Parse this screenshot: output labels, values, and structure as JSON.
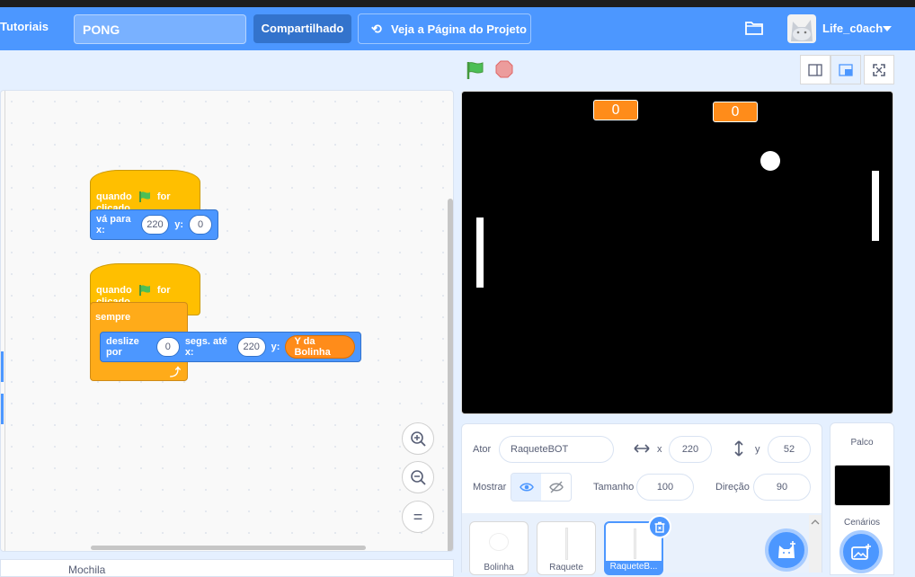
{
  "menubar": {
    "tutorials": "Tutoriais",
    "project_title": "PONG",
    "share": "Compartilhado",
    "see_project": "Veja a Página do Projeto",
    "username": "Life_c0ach"
  },
  "code": {
    "script1": {
      "hat_prefix": "quando",
      "hat_suffix": "for clicado",
      "goto_label": "vá para x:",
      "goto_x": "220",
      "goto_y_label": "y:",
      "goto_y": "0"
    },
    "script2": {
      "hat_prefix": "quando",
      "hat_suffix": "for clicado",
      "forever": "sempre",
      "glide_label": "deslize por",
      "glide_secs": "0",
      "glide_mid": "segs. até x:",
      "glide_x": "220",
      "glide_y_label": "y:",
      "glide_reporter": "Y da Bolinha"
    },
    "backpack": "Mochila"
  },
  "stage": {
    "score_left": "0",
    "score_right": "0"
  },
  "sprite_info": {
    "sprite_label": "Ator",
    "sprite_name": "RaqueteBOT",
    "x_label": "x",
    "x_value": "220",
    "y_label": "y",
    "y_value": "52",
    "show_label": "Mostrar",
    "size_label": "Tamanho",
    "size_value": "100",
    "direction_label": "Direção",
    "direction_value": "90"
  },
  "sprites": [
    {
      "name": "Bolinha"
    },
    {
      "name": "Raquete"
    },
    {
      "name": "RaqueteB..."
    }
  ],
  "stage_panel": {
    "title": "Palco",
    "backdrops": "Cenários"
  },
  "colors": {
    "menu_blue": "#4c97ff",
    "events_yellow": "#ffbf00",
    "motion_blue": "#4c97ff",
    "control_orange": "#ffab19",
    "sensing_orange": "#ff8c1a"
  }
}
